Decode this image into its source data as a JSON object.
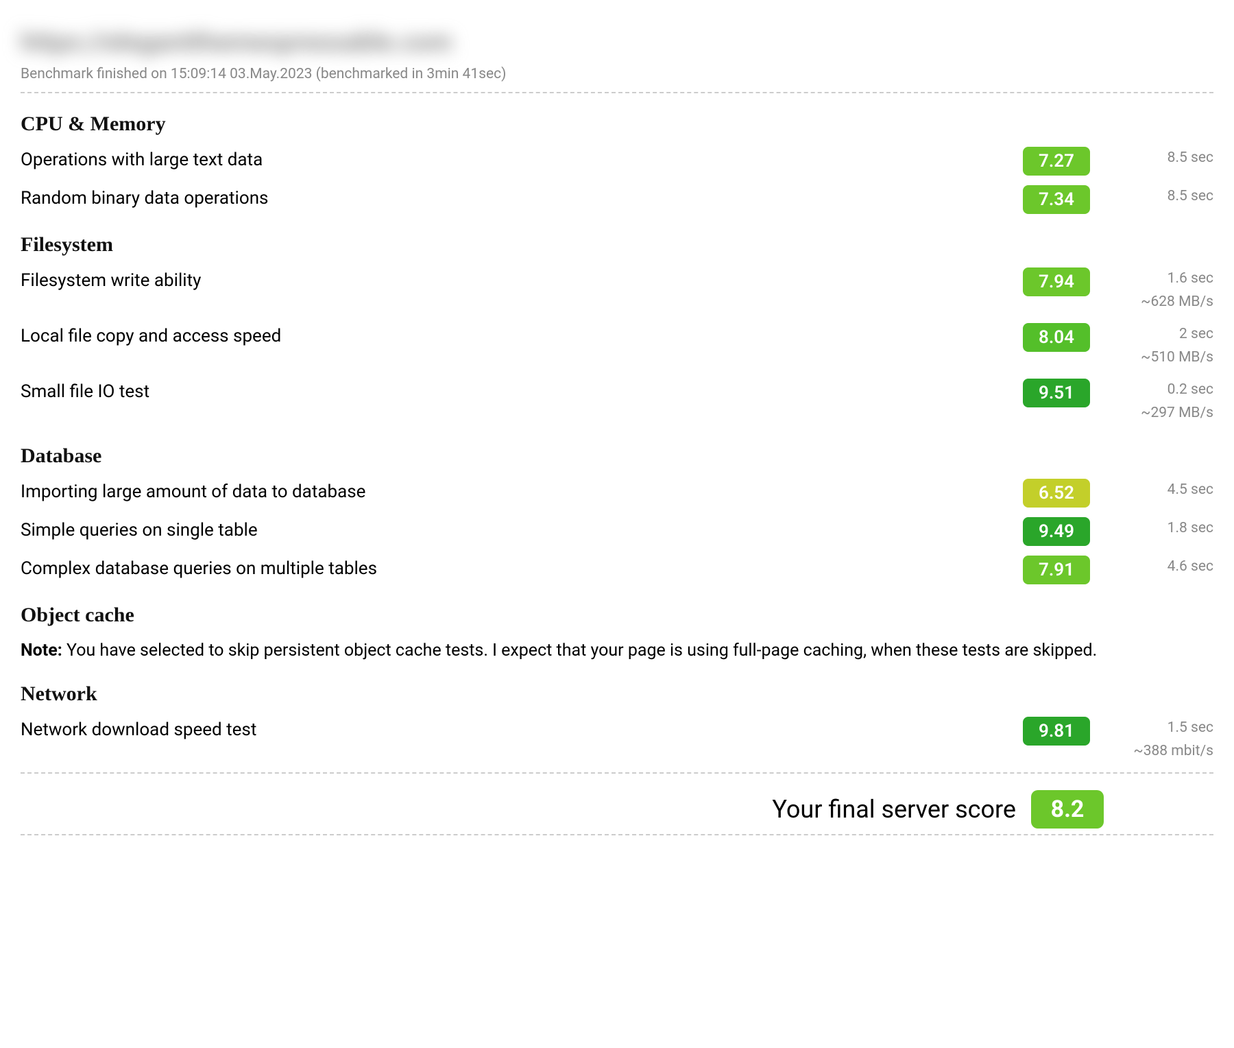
{
  "header": {
    "url_blurred": "https://elegantthemespressable.com",
    "finished_line": "Benchmark finished on 15:09:14 03.May.2023 (benchmarked in 3min 41sec)"
  },
  "score_colors": {
    "yellow": "#c3cf2a",
    "lightgreen": "#6cc72b",
    "midgreen": "#54bf2a",
    "green": "#2aa62a"
  },
  "sections": [
    {
      "title": "CPU & Memory",
      "rows": [
        {
          "label": "Operations with large text data",
          "score": "7.27",
          "color": "lightgreen",
          "meta": [
            "8.5 sec"
          ]
        },
        {
          "label": "Random binary data operations",
          "score": "7.34",
          "color": "lightgreen",
          "meta": [
            "8.5 sec"
          ]
        }
      ]
    },
    {
      "title": "Filesystem",
      "rows": [
        {
          "label": "Filesystem write ability",
          "score": "7.94",
          "color": "lightgreen",
          "meta": [
            "1.6 sec",
            "~628 MB/s"
          ]
        },
        {
          "label": "Local file copy and access speed",
          "score": "8.04",
          "color": "midgreen",
          "meta": [
            "2 sec",
            "~510 MB/s"
          ]
        },
        {
          "label": "Small file IO test",
          "score": "9.51",
          "color": "green",
          "meta": [
            "0.2 sec",
            "~297 MB/s"
          ]
        }
      ]
    },
    {
      "title": "Database",
      "rows": [
        {
          "label": "Importing large amount of data to database",
          "score": "6.52",
          "color": "yellow",
          "meta": [
            "4.5 sec"
          ]
        },
        {
          "label": "Simple queries on single table",
          "score": "9.49",
          "color": "green",
          "meta": [
            "1.8 sec"
          ]
        },
        {
          "label": "Complex database queries on multiple tables",
          "score": "7.91",
          "color": "lightgreen",
          "meta": [
            "4.6 sec"
          ]
        }
      ]
    },
    {
      "title": "Object cache",
      "note_bold": "Note:",
      "note_text": " You have selected to skip persistent object cache tests. I expect that your page is using full-page caching, when these tests are skipped.",
      "rows": []
    },
    {
      "title": "Network",
      "rows": [
        {
          "label": "Network download speed test",
          "score": "9.81",
          "color": "green",
          "meta": [
            "1.5 sec",
            "~388 mbit/s"
          ]
        }
      ]
    }
  ],
  "final": {
    "label": "Your final server score",
    "score": "8.2",
    "color": "lightgreen"
  }
}
